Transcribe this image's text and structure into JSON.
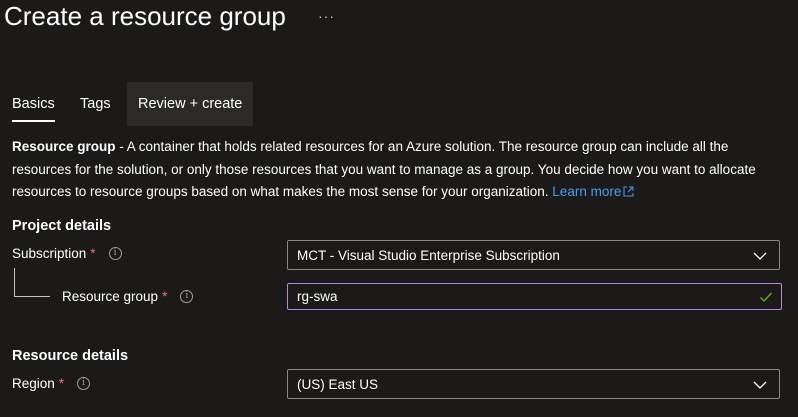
{
  "header": {
    "title": "Create a resource group",
    "more": "···"
  },
  "tabs": [
    {
      "label": "Basics",
      "active": true
    },
    {
      "label": "Tags",
      "active": false
    },
    {
      "label": "Review + create",
      "active": false
    }
  ],
  "description": {
    "term": "Resource group",
    "text": " - A container that holds related resources for an Azure solution. The resource group can include all the resources for the solution, or only those resources that you want to manage as a group. You decide how you want to allocate resources to resource groups based on what makes the most sense for your organization. ",
    "link": "Learn more"
  },
  "project": {
    "heading": "Project details",
    "subscription": {
      "label": "Subscription",
      "required": "*",
      "value": "MCT - Visual Studio Enterprise Subscription"
    },
    "resource_group": {
      "label": "Resource group",
      "required": "*",
      "value": "rg-swa"
    }
  },
  "resource": {
    "heading": "Resource details",
    "region": {
      "label": "Region",
      "required": "*",
      "value": "(US) East US"
    }
  },
  "colors": {
    "background": "#1b1a19",
    "link": "#479ef5",
    "required": "#f1707b",
    "valid_check": "#6bb700",
    "focus_border": "#b589d6"
  }
}
